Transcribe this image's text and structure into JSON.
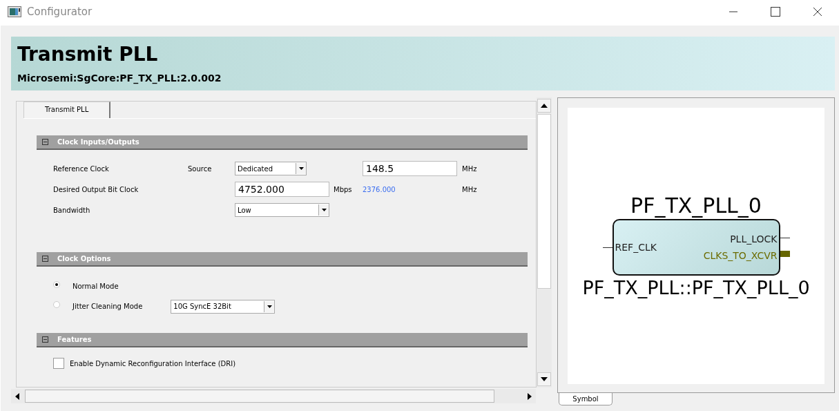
{
  "window": {
    "title": "Configurator"
  },
  "header": {
    "title": "Transmit PLL",
    "subtitle": "Microsemi:SgCore:PF_TX_PLL:2.0.002"
  },
  "tabs": [
    {
      "label": "Transmit PLL",
      "selected": true
    }
  ],
  "sections": [
    {
      "title": "Clock Inputs/Outputs",
      "expanded": true,
      "kind": "fields",
      "rows": [
        {
          "label": "Reference Clock",
          "source_label": "Source",
          "dropdown": "Dedicated",
          "field": "148.5",
          "unit": "MHz"
        },
        {
          "label": "Desired Output Bit Clock",
          "field": "4752.000",
          "unit": "Mbps",
          "derived": "2376.000",
          "derived_unit": "MHz"
        },
        {
          "label": "Bandwidth",
          "dropdown": "Low"
        }
      ]
    },
    {
      "title": "Clock Options",
      "expanded": true,
      "kind": "radios",
      "rows": [
        {
          "label": "Normal Mode",
          "selected": true
        },
        {
          "label": "Jitter Cleaning Mode",
          "selected": false,
          "dropdown": "10G SyncE 32Bit"
        }
      ]
    },
    {
      "title": "Features",
      "expanded": true,
      "kind": "checkboxes",
      "rows": [
        {
          "label": "Enable Dynamic Reconfiguration Interface (DRI)",
          "checked": false
        }
      ]
    }
  ],
  "symbol": {
    "instance": "PF_TX_PLL_0",
    "type_name": "PF_TX_PLL::PF_TX_PLL_0",
    "left_ports": [
      {
        "name": "REF_CLK",
        "kind": "signal"
      }
    ],
    "right_ports": [
      {
        "name": "PLL_LOCK",
        "kind": "signal"
      },
      {
        "name": "CLKS_TO_XCVR",
        "kind": "bus"
      }
    ]
  },
  "view_tabs": [
    {
      "label": "Symbol",
      "selected": true
    }
  ]
}
